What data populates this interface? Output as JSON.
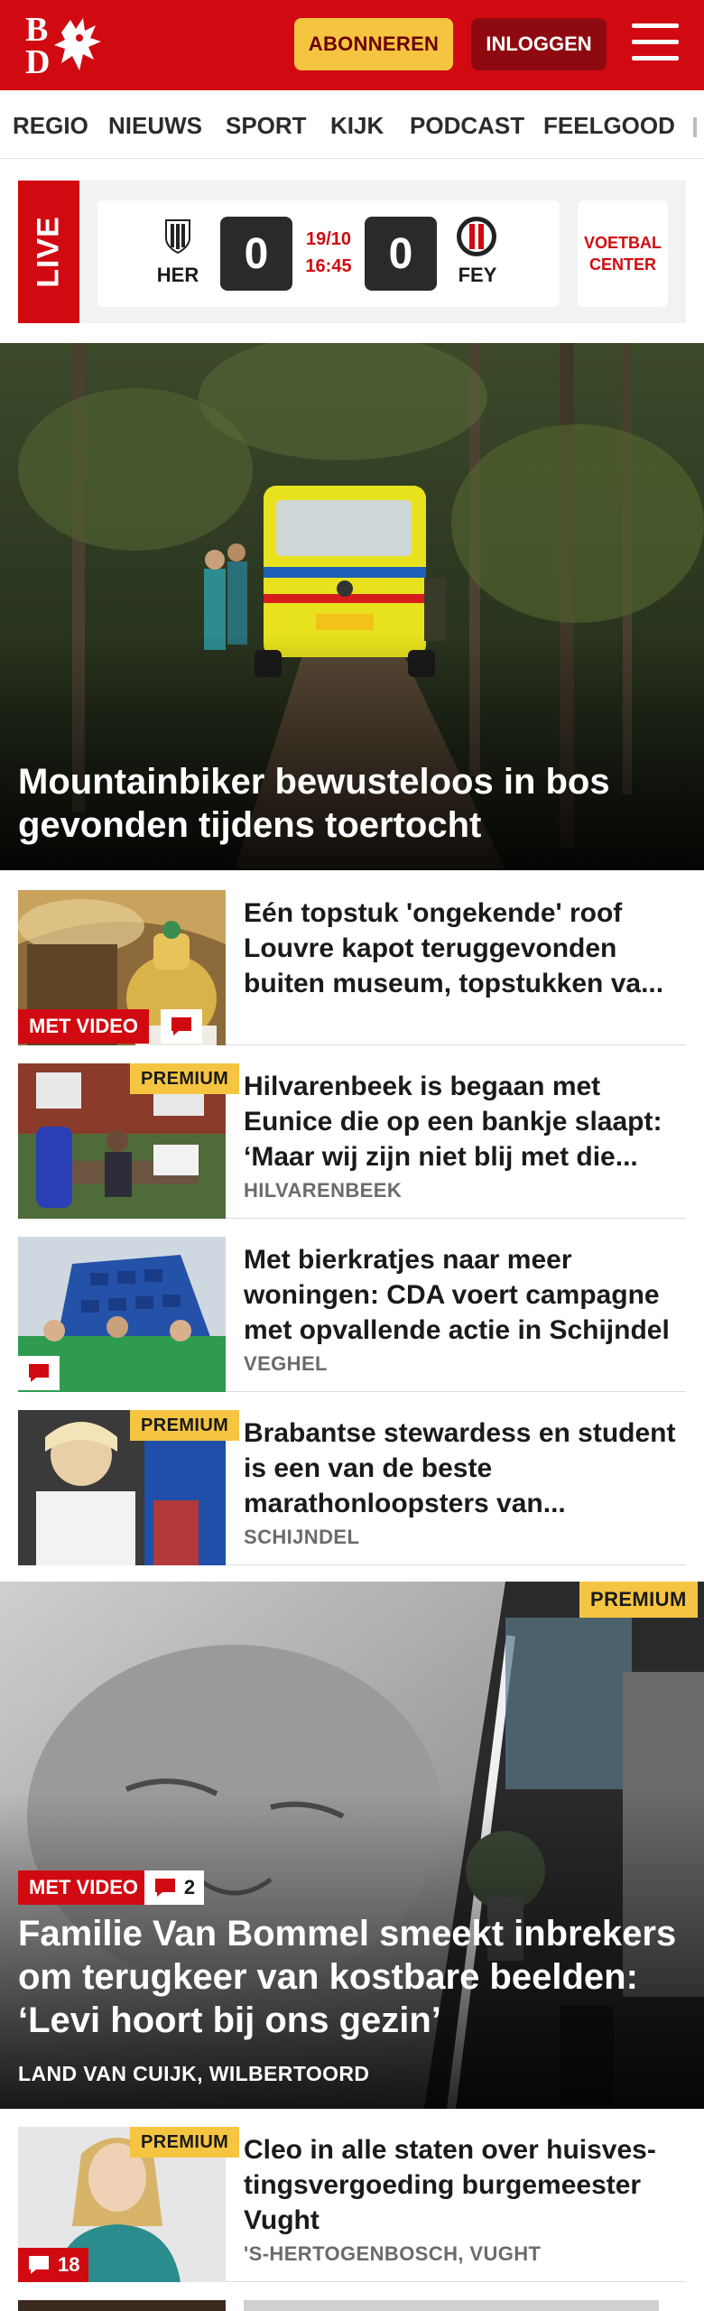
{
  "header": {
    "logo_text_top": "B",
    "logo_text_bottom": "D",
    "subscribe_label": "ABONNEREN",
    "login_label": "INLOGGEN",
    "brand_color": "#d10a11"
  },
  "nav": {
    "items": [
      "REGIO",
      "NIEUWS",
      "SPORT",
      "KIJK",
      "PODCAST",
      "FEELGOOD"
    ]
  },
  "live": {
    "label": "LIVE",
    "home_team": "HER",
    "home_score": "0",
    "away_team": "FEY",
    "away_score": "0",
    "date": "19/10",
    "time": "16:45",
    "center_label": "VOETBAL CENTER"
  },
  "hero": {
    "title": "Mountainbiker bewusteloos in bos gevonden tijdens toertocht"
  },
  "articles": [
    {
      "title": "Eén topstuk 'ongekende' roof Louvre kapot teruggevonden buiten museum, topstukken va...",
      "location": "",
      "video_label": "MET VIDEO"
    },
    {
      "title": "Hilvarenbeek is begaan met Eunice die op een bankje slaapt: ‘Maar wij zijn niet blij met die...",
      "location": "HILVARENBEEK",
      "premium_label": "PREMIUM"
    },
    {
      "title": "Met bierkratjes naar meer woningen: CDA voert campagne met opvallende actie in Schijndel",
      "location": "VEGHEL"
    },
    {
      "title": "Brabantse stewardess en student is een van de beste marathonloopsters van...",
      "location": "SCHIJNDEL",
      "premium_label": "PREMIUM"
    }
  ],
  "big_article": {
    "premium_label": "PREMIUM",
    "video_label": "MET VIDEO",
    "comment_count": "2",
    "title": "Familie Van Bommel smeekt inbrekers om terugkeer van kostbare beelden: ‘Levi hoort bij ons gezin’",
    "location": "LAND VAN CUIJK, WILBERTOORD"
  },
  "last_article": {
    "premium_label": "PREMIUM",
    "comment_count": "18",
    "title": "Cleo in alle staten over huisves­tingsvergoeding burgemeester Vught",
    "location": "'S-HERTOGENBOSCH, VUGHT"
  }
}
